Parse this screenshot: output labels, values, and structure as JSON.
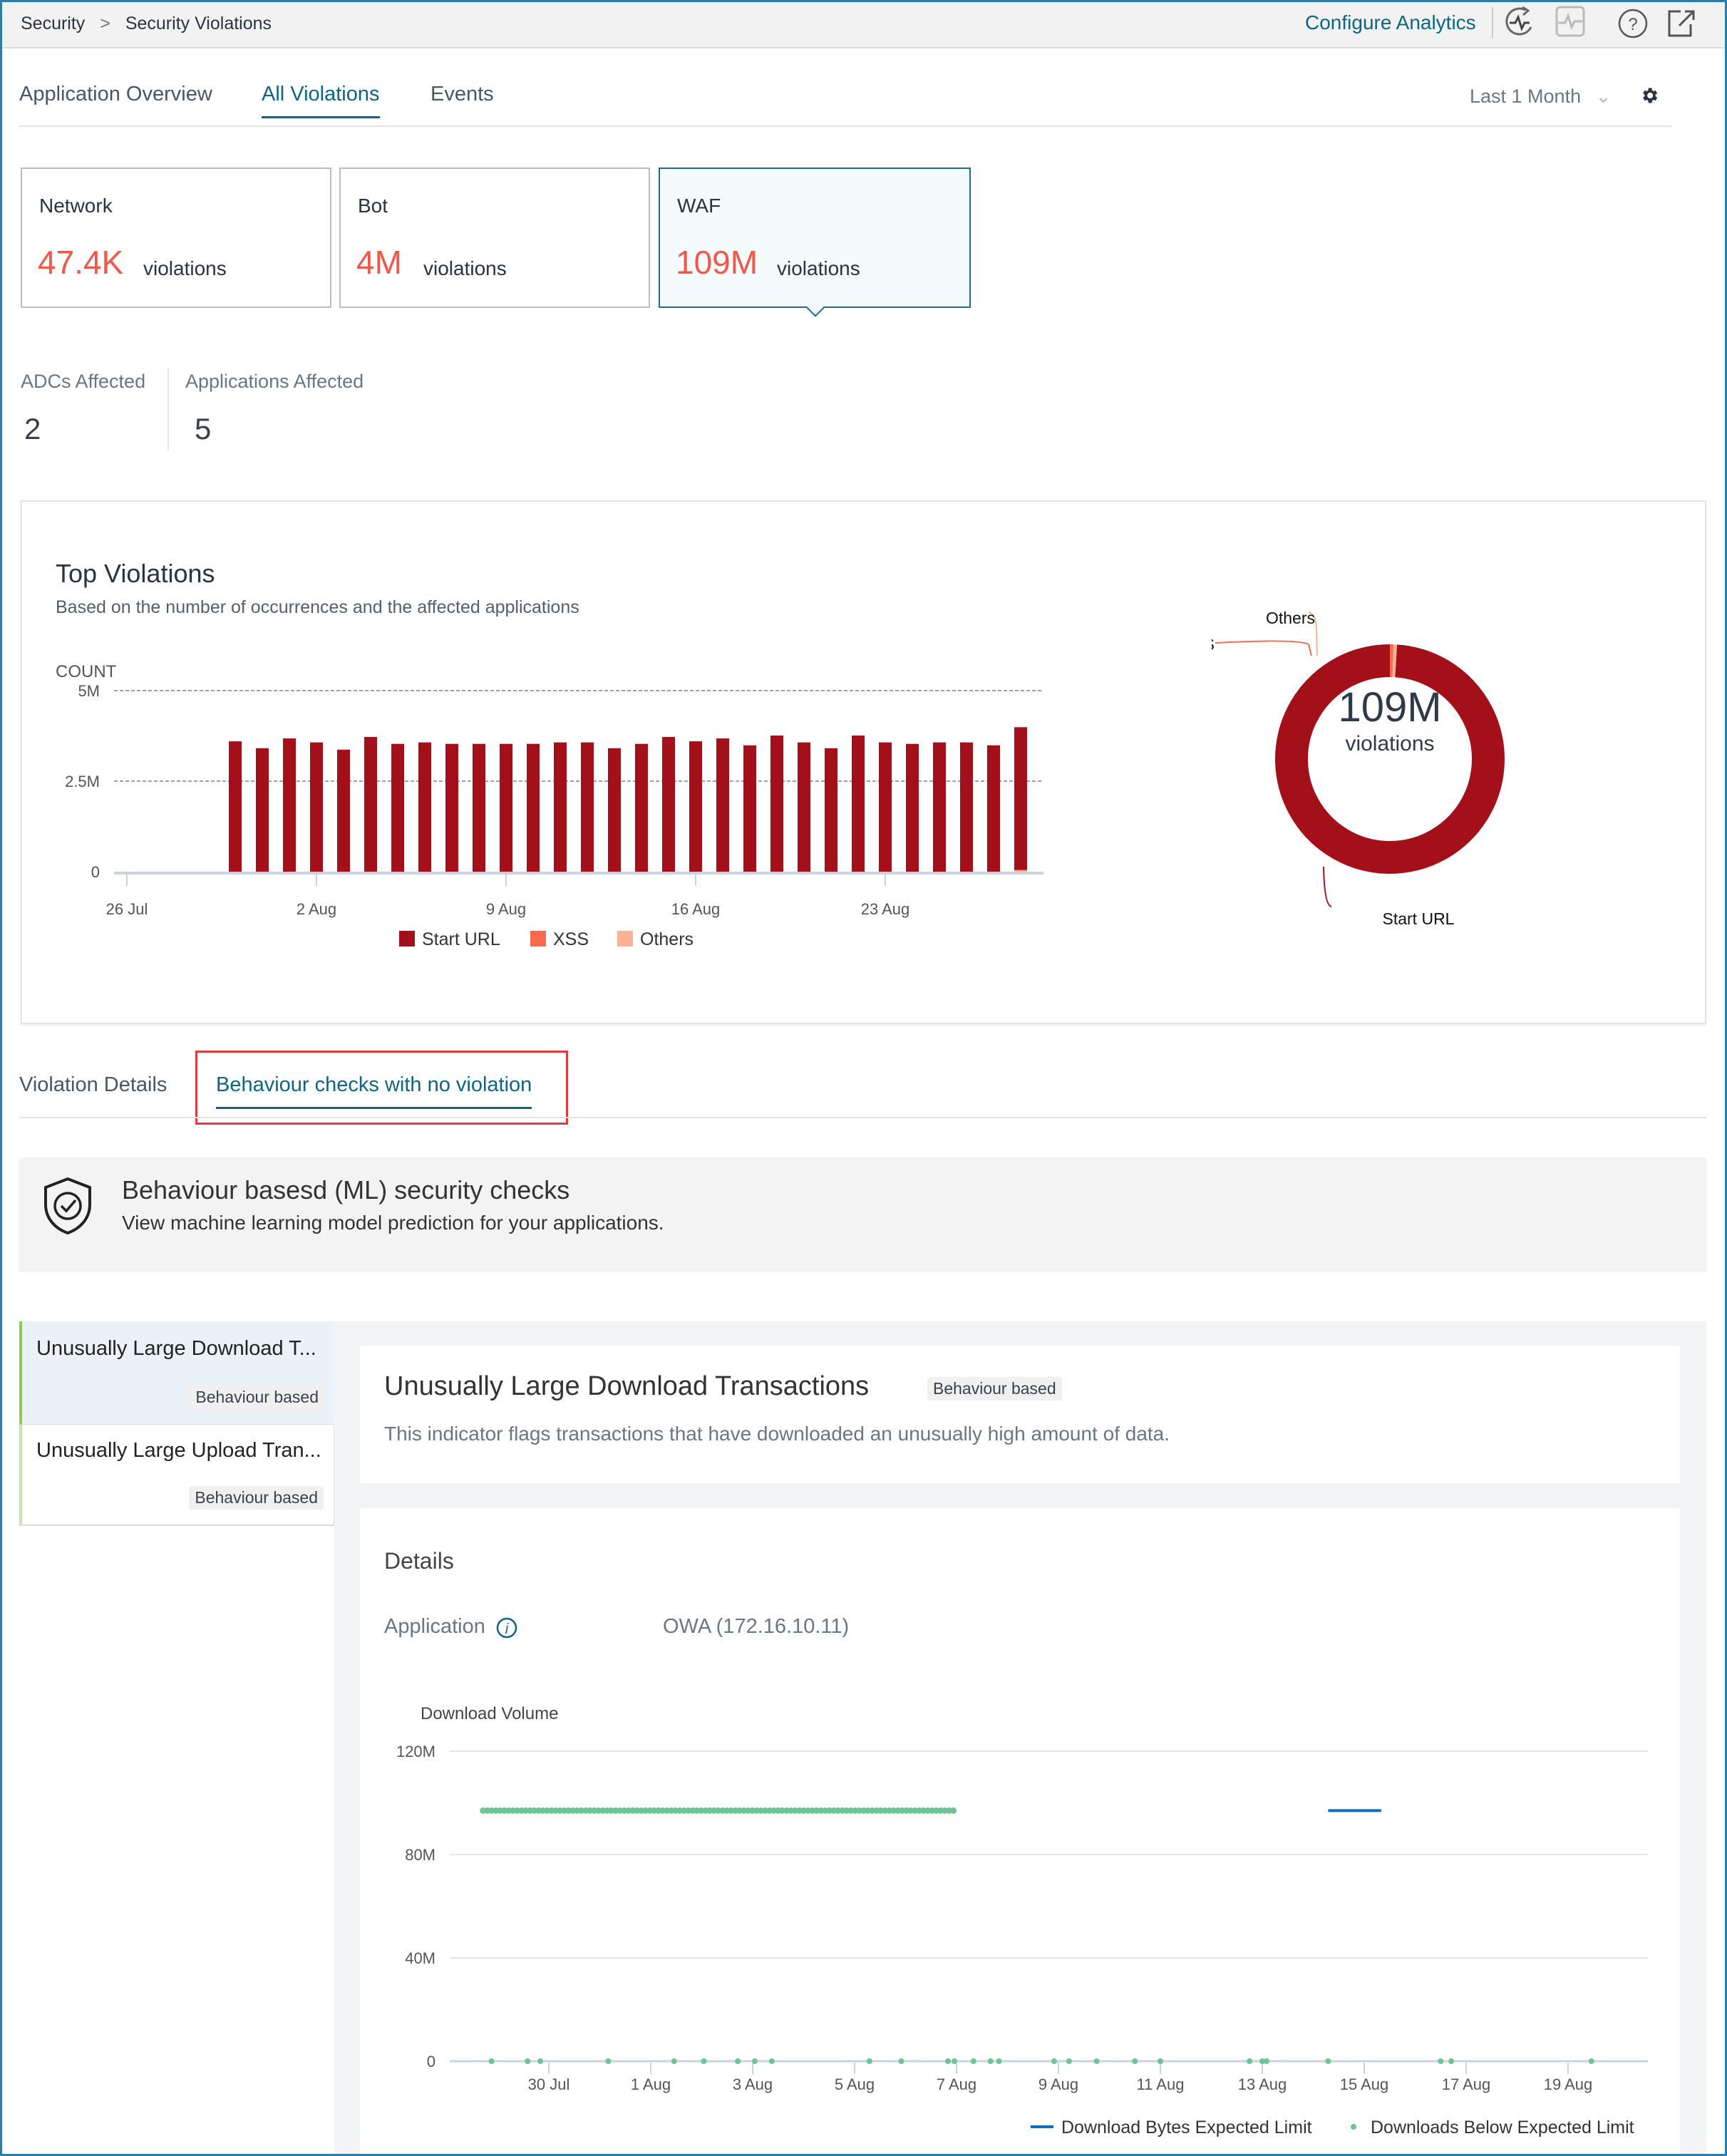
{
  "breadcrumb": {
    "root": "Security",
    "current": "Security Violations"
  },
  "header": {
    "configure_analytics": "Configure Analytics",
    "icons": [
      "health-refresh-icon",
      "pulse-monitor-icon",
      "help-icon",
      "external-link-icon"
    ]
  },
  "tabs": [
    {
      "label": "Application Overview"
    },
    {
      "label": "All Violations",
      "active": true
    },
    {
      "label": "Events"
    }
  ],
  "time_filter": {
    "selected": "Last 1 Month"
  },
  "cards": [
    {
      "title": "Network",
      "value": "47.4K",
      "unit": "violations"
    },
    {
      "title": "Bot",
      "value": "4M",
      "unit": "violations"
    },
    {
      "title": "WAF",
      "value": "109M",
      "unit": "violations",
      "selected": true
    }
  ],
  "affected": {
    "adcs_label": "ADCs Affected",
    "adcs_value": "2",
    "apps_label": "Applications Affected",
    "apps_value": "5"
  },
  "top_violations": {
    "title": "Top Violations",
    "subtitle": "Based on the number of occurrences and the affected applications"
  },
  "colors": {
    "start_url": "#a4101a",
    "xss": "#f96a4f",
    "others": "#f9b294",
    "accent": "#0d6585",
    "green": "#6dc594",
    "blue": "#0b6cbf"
  },
  "chart_data": [
    {
      "type": "bar",
      "ylabel": "COUNT",
      "ylim": [
        0,
        5000000
      ],
      "yticks": [
        "0",
        "2.5M",
        "5M"
      ],
      "xticks": [
        "26 Jul",
        "2 Aug",
        "9 Aug",
        "16 Aug",
        "23 Aug"
      ],
      "stacked": true,
      "grid": true,
      "legend": "bottom",
      "categories": [
        "30 Jul",
        "31 Jul",
        "1 Aug",
        "2 Aug",
        "3 Aug",
        "4 Aug",
        "5 Aug",
        "6 Aug",
        "7 Aug",
        "8 Aug",
        "9 Aug",
        "10 Aug",
        "11 Aug",
        "12 Aug",
        "13 Aug",
        "14 Aug",
        "15 Aug",
        "16 Aug",
        "17 Aug",
        "18 Aug",
        "19 Aug",
        "20 Aug",
        "21 Aug",
        "22 Aug",
        "23 Aug",
        "24 Aug",
        "25 Aug",
        "26 Aug",
        "27 Aug",
        "28 Aug"
      ],
      "series": [
        {
          "name": "Start URL",
          "values": [
            3600000,
            3410000,
            3680000,
            3570000,
            3370000,
            3720000,
            3530000,
            3570000,
            3530000,
            3530000,
            3530000,
            3530000,
            3570000,
            3570000,
            3410000,
            3530000,
            3720000,
            3600000,
            3680000,
            3490000,
            3760000,
            3570000,
            3410000,
            3760000,
            3570000,
            3530000,
            3570000,
            3570000,
            3490000,
            3940000
          ]
        },
        {
          "name": "XSS",
          "values": [
            0,
            0,
            0,
            0,
            0,
            0,
            0,
            0,
            0,
            0,
            0,
            0,
            0,
            0,
            0,
            0,
            0,
            0,
            0,
            0,
            0,
            0,
            0,
            0,
            0,
            0,
            0,
            0,
            0,
            10000
          ]
        },
        {
          "name": "Others",
          "values": [
            0,
            0,
            0,
            0,
            0,
            0,
            0,
            0,
            0,
            0,
            0,
            0,
            0,
            0,
            0,
            0,
            0,
            0,
            0,
            0,
            0,
            0,
            0,
            0,
            0,
            0,
            0,
            0,
            0,
            40000
          ]
        }
      ]
    },
    {
      "type": "pie",
      "donut": true,
      "center_value": "109M",
      "center_label": "violations",
      "slices": [
        {
          "name": "Start URL",
          "value": 99.0
        },
        {
          "name": "XSS",
          "value": 0.5
        },
        {
          "name": "Others",
          "value": 0.5
        }
      ]
    },
    {
      "type": "scatter",
      "title": "Download Volume",
      "ylim": [
        0,
        120000000
      ],
      "yticks": [
        "0",
        "40M",
        "80M",
        "120M"
      ],
      "xticks": [
        "30 Jul",
        "1 Aug",
        "3 Aug",
        "5 Aug",
        "7 Aug",
        "9 Aug",
        "11 Aug",
        "13 Aug",
        "15 Aug",
        "17 Aug",
        "19 Aug"
      ],
      "legend": "bottom-right",
      "series": [
        {
          "name": "Download Bytes Expected Limit",
          "kind": "line",
          "segments": [
            {
              "from": "08-14T07:00",
              "to": "08-15T08:00",
              "value": 97000000
            }
          ]
        },
        {
          "name": "Downloads Below Expected Limit",
          "kind": "points",
          "band": {
            "from": "07-28T17:00",
            "to": "08-07T00:00",
            "value": 97000000
          },
          "points_at_zero": [
            "07-28T21:00",
            "07-29T14:00",
            "07-29T20:00",
            "07-31T04:00",
            "08-01T11:00",
            "08-02T01:00",
            "08-02T17:00",
            "08-03T01:00",
            "08-03T09:00",
            "08-05T07:00",
            "08-05T22:00",
            "08-06T20:00",
            "08-06T23:00",
            "08-07T08:00",
            "08-07T16:00",
            "08-07T20:00",
            "08-08T22:00",
            "08-09T05:00",
            "08-09T18:00",
            "08-10T12:00",
            "08-11T00:00",
            "08-12T18:00",
            "08-13T00:00",
            "08-13T02:00",
            "08-14T07:00",
            "08-16T12:00",
            "08-16T17:00",
            "08-19T11:00"
          ]
        }
      ]
    }
  ],
  "detail_tabs": [
    {
      "label": "Violation Details"
    },
    {
      "label": "Behaviour checks with no violation",
      "active": true
    }
  ],
  "banner": {
    "title": "Behaviour basesd (ML) security checks",
    "subtitle": "View machine learning model prediction for your applications."
  },
  "indicators": [
    {
      "title": "Unusually Large Download T...",
      "badge": "Behaviour based",
      "selected": true
    },
    {
      "title": "Unusually Large Upload Tran...",
      "badge": "Behaviour based"
    }
  ],
  "indicator_detail": {
    "title": "Unusually Large Download Transactions",
    "badge": "Behaviour based",
    "description": "This indicator flags transactions that have downloaded an unusually high amount of data.",
    "details_heading": "Details",
    "application_label": "Application",
    "application_value": "OWA (172.16.10.11)"
  }
}
